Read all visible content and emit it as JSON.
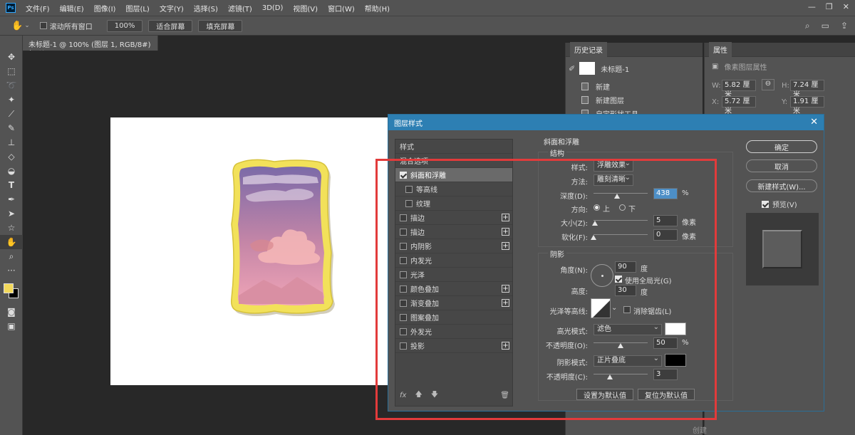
{
  "app": {
    "menu": [
      "文件(F)",
      "编辑(E)",
      "图像(I)",
      "图层(L)",
      "文字(Y)",
      "选择(S)",
      "滤镜(T)",
      "3D(D)",
      "视图(V)",
      "窗口(W)",
      "帮助(H)"
    ],
    "logo_text": "Ps"
  },
  "options_bar": {
    "scroll_all": "滚动所有窗口",
    "zoom": "100%",
    "fit_screen": "适合屏幕",
    "fill_screen": "填充屏幕"
  },
  "document": {
    "tab_title": "未标题-1 @ 100% (图层 1, RGB/8#) *"
  },
  "history_panel": {
    "tab": "历史记录",
    "snapshot": "未标题-1",
    "items": [
      "新建",
      "新建图层",
      "自定形状工具"
    ]
  },
  "properties_panel": {
    "tab": "属性",
    "subtitle": "像素图层属性",
    "w_label": "W:",
    "w_value": "5.82 厘米",
    "h_label": "H:",
    "h_value": "7.24 厘米",
    "x_label": "X:",
    "x_value": "5.72 厘米",
    "y_label": "Y:",
    "y_value": "1.91 厘米",
    "create": "创建"
  },
  "dialog": {
    "title": "图层样式",
    "style_list": {
      "styles": "样式",
      "blend_options": "混合选项",
      "items": [
        {
          "label": "斜面和浮雕",
          "checked": true,
          "selected": true,
          "plus": false,
          "sub": false
        },
        {
          "label": "等高线",
          "checked": false,
          "selected": false,
          "plus": false,
          "sub": true
        },
        {
          "label": "纹理",
          "checked": false,
          "selected": false,
          "plus": false,
          "sub": true
        },
        {
          "label": "描边",
          "checked": false,
          "selected": false,
          "plus": true,
          "sub": false
        },
        {
          "label": "描边",
          "checked": false,
          "selected": false,
          "plus": true,
          "sub": false
        },
        {
          "label": "内阴影",
          "checked": false,
          "selected": false,
          "plus": true,
          "sub": false
        },
        {
          "label": "内发光",
          "checked": false,
          "selected": false,
          "plus": false,
          "sub": false
        },
        {
          "label": "光泽",
          "checked": false,
          "selected": false,
          "plus": false,
          "sub": false
        },
        {
          "label": "颜色叠加",
          "checked": false,
          "selected": false,
          "plus": true,
          "sub": false
        },
        {
          "label": "渐变叠加",
          "checked": false,
          "selected": false,
          "plus": true,
          "sub": false
        },
        {
          "label": "图案叠加",
          "checked": false,
          "selected": false,
          "plus": false,
          "sub": false
        },
        {
          "label": "外发光",
          "checked": false,
          "selected": false,
          "plus": false,
          "sub": false
        },
        {
          "label": "投影",
          "checked": false,
          "selected": false,
          "plus": true,
          "sub": false
        }
      ],
      "fx": "fx"
    },
    "bevel": {
      "section_title": "斜面和浮雕",
      "structure_title": "结构",
      "style_label": "样式:",
      "style_value": "浮雕效果",
      "method_label": "方法:",
      "method_value": "雕刻清晰",
      "depth_label": "深度(D):",
      "depth_value": "438",
      "depth_unit": "%",
      "depth_fraction": 0.44,
      "direction_label": "方向:",
      "direction_up": "上",
      "direction_down": "下",
      "size_label": "大小(Z):",
      "size_value": "5",
      "size_unit": "像素",
      "size_fraction": 0.02,
      "soften_label": "软化(F):",
      "soften_value": "0",
      "soften_unit": "像素",
      "soften_fraction": 0.0
    },
    "shading": {
      "title": "阴影",
      "angle_label": "角度(N):",
      "angle_value": "90",
      "angle_unit": "度",
      "global_light": "使用全局光(G)",
      "altitude_label": "高度:",
      "altitude_value": "30",
      "altitude_unit": "度",
      "gloss_label": "光泽等高线:",
      "anti_alias": "消除锯齿(L)",
      "highlight_mode_label": "高光模式:",
      "highlight_mode_value": "滤色",
      "highlight_color": "#ffffff",
      "highlight_opacity_label": "不透明度(O):",
      "highlight_opacity_value": "50",
      "opacity_unit": "%",
      "highlight_opacity_fraction": 0.5,
      "shadow_mode_label": "阴影模式:",
      "shadow_mode_value": "正片叠底",
      "shadow_color": "#000000",
      "shadow_opacity_label": "不透明度(C):",
      "shadow_opacity_value": "3",
      "shadow_opacity_fraction": 0.3
    },
    "make_default": "设置为默认值",
    "reset_default": "复位为默认值",
    "ok": "确定",
    "cancel": "取消",
    "new_style": "新建样式(W)...",
    "preview": "预览(V)"
  },
  "colors": {
    "accent_title": "#2d7fb3",
    "highlight_outline": "#e23b3b",
    "frame_yellow": "#f2e15a"
  }
}
